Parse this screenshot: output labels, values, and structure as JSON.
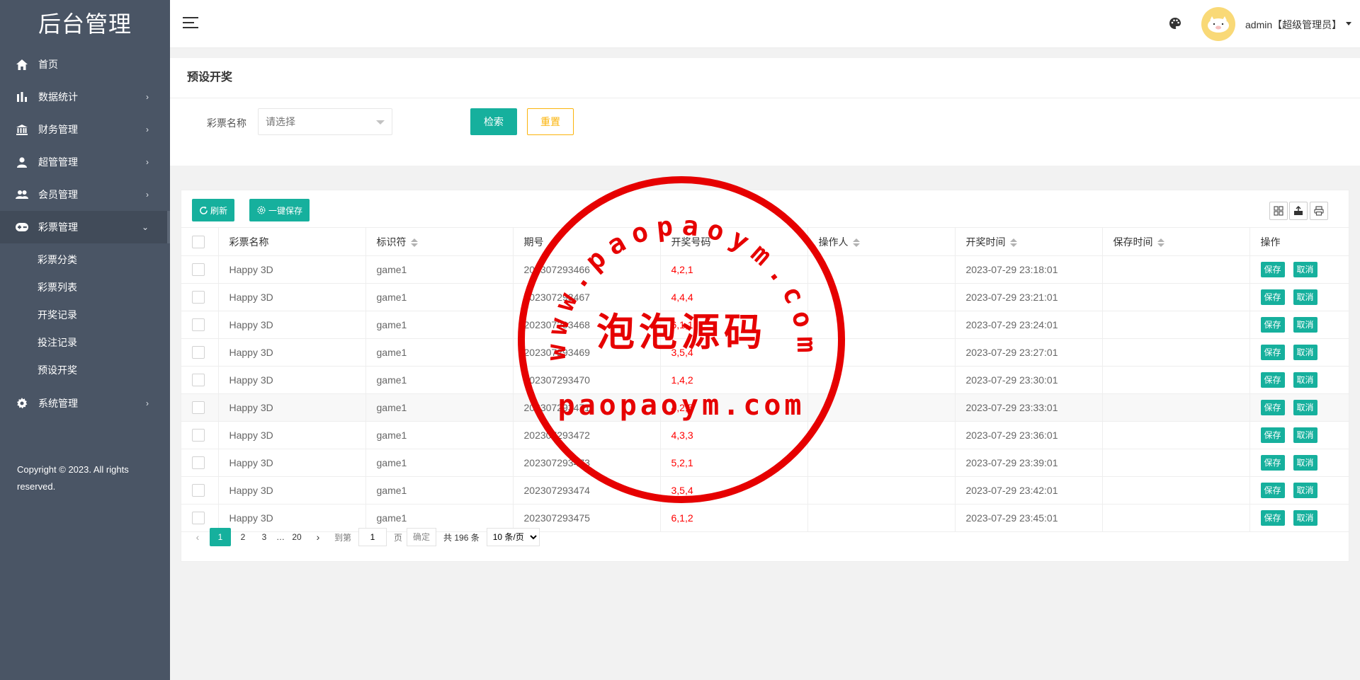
{
  "sidebar": {
    "brand": "后台管理",
    "items": [
      {
        "label": "首页",
        "icon": "home-icon",
        "arrow": ""
      },
      {
        "label": "数据统计",
        "icon": "bar-chart-icon",
        "arrow": "›"
      },
      {
        "label": "财务管理",
        "icon": "bank-icon",
        "arrow": "›"
      },
      {
        "label": "超管管理",
        "icon": "user-icon",
        "arrow": "›"
      },
      {
        "label": "会员管理",
        "icon": "users-icon",
        "arrow": "›"
      },
      {
        "label": "彩票管理",
        "icon": "gamepad-icon",
        "arrow": "⌄"
      }
    ],
    "submenu": [
      "彩票分类",
      "彩票列表",
      "开奖记录",
      "投注记录",
      "预设开奖"
    ],
    "system": {
      "label": "系统管理",
      "icon": "gear-icon",
      "arrow": "›"
    },
    "copyright": "Copyright © 2023. All rights reserved."
  },
  "header": {
    "user": "admin【超级管理员】"
  },
  "search": {
    "title": "预设开奖",
    "field_label": "彩票名称",
    "select_placeholder": "请选择",
    "search_button": "检索",
    "reset_button": "重置"
  },
  "toolbar": {
    "refresh": "刷新",
    "save_all": "一键保存"
  },
  "table": {
    "headers": [
      "彩票名称",
      "标识符",
      "期号",
      "开奖号码",
      "操作人",
      "开奖时间",
      "保存时间",
      "操作"
    ],
    "rows": [
      {
        "name": "Happy 3D",
        "code": "game1",
        "issue": "202307293466",
        "numbers": "4,2,1",
        "operator": "",
        "draw_time": "2023-07-29 23:18:01",
        "save_time": ""
      },
      {
        "name": "Happy 3D",
        "code": "game1",
        "issue": "202307293467",
        "numbers": "4,4,4",
        "operator": "",
        "draw_time": "2023-07-29 23:21:01",
        "save_time": ""
      },
      {
        "name": "Happy 3D",
        "code": "game1",
        "issue": "202307293468",
        "numbers": "6,1,1",
        "operator": "",
        "draw_time": "2023-07-29 23:24:01",
        "save_time": ""
      },
      {
        "name": "Happy 3D",
        "code": "game1",
        "issue": "202307293469",
        "numbers": "3,5,4",
        "operator": "",
        "draw_time": "2023-07-29 23:27:01",
        "save_time": ""
      },
      {
        "name": "Happy 3D",
        "code": "game1",
        "issue": "202307293470",
        "numbers": "1,4,2",
        "operator": "",
        "draw_time": "2023-07-29 23:30:01",
        "save_time": ""
      },
      {
        "name": "Happy 3D",
        "code": "game1",
        "issue": "202307293471",
        "numbers": "4,2,5",
        "operator": "",
        "draw_time": "2023-07-29 23:33:01",
        "save_time": ""
      },
      {
        "name": "Happy 3D",
        "code": "game1",
        "issue": "202307293472",
        "numbers": "4,3,3",
        "operator": "",
        "draw_time": "2023-07-29 23:36:01",
        "save_time": ""
      },
      {
        "name": "Happy 3D",
        "code": "game1",
        "issue": "202307293473",
        "numbers": "5,2,1",
        "operator": "",
        "draw_time": "2023-07-29 23:39:01",
        "save_time": ""
      },
      {
        "name": "Happy 3D",
        "code": "game1",
        "issue": "202307293474",
        "numbers": "3,5,4",
        "operator": "",
        "draw_time": "2023-07-29 23:42:01",
        "save_time": ""
      },
      {
        "name": "Happy 3D",
        "code": "game1",
        "issue": "202307293475",
        "numbers": "6,1,2",
        "operator": "",
        "draw_time": "2023-07-29 23:45:01",
        "save_time": ""
      }
    ],
    "save_label": "保存",
    "cancel_label": "取消"
  },
  "pagination": {
    "pages": [
      "1",
      "2",
      "3"
    ],
    "ellipsis": "…",
    "last_page": "20",
    "goto_label": "到第",
    "goto_value": "1",
    "page_suffix": "页",
    "confirm": "确定",
    "total": "共 196 条",
    "page_size": "10 条/页"
  },
  "watermark": {
    "arc_text": "www.paopaoym.com",
    "center_text": "泡泡源码",
    "bottom_text": "paopaoym.com",
    "color": "#e60000"
  },
  "colors": {
    "sidebar_bg": "#4a5565",
    "primary": "#16b09d",
    "warning": "#fbb40c",
    "number_red": "#ff0000"
  }
}
